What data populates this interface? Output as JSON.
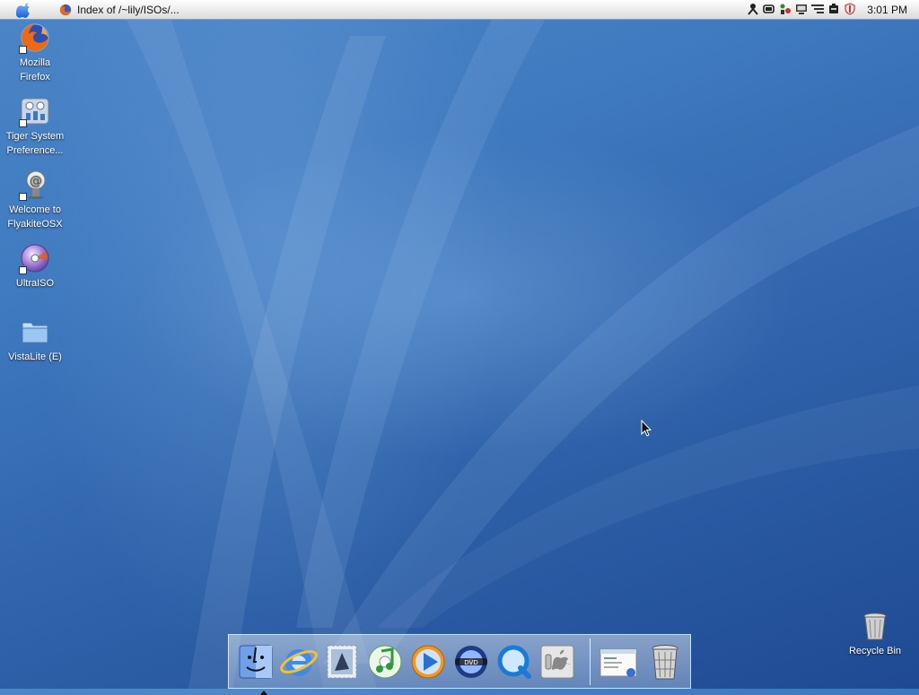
{
  "menubar": {
    "task_title": "Index of /~lily/ISOs/...",
    "clock": "3:01 PM",
    "tray_icons": [
      "speech-icon",
      "battery-icon",
      "network-icon",
      "monitor-icon",
      "volume-bars-icon",
      "connection-icon",
      "shield-icon"
    ]
  },
  "desktop": {
    "icons": [
      {
        "label1": "Mozilla",
        "label2": "Firefox",
        "icon": "firefox-icon"
      },
      {
        "label1": "Tiger System",
        "label2": "Preference...",
        "icon": "system-preferences-icon"
      },
      {
        "label1": "Welcome to",
        "label2": "FlyakiteOSX",
        "icon": "welcome-icon"
      },
      {
        "label1": "UltraISO",
        "label2": "",
        "icon": "disc-icon"
      },
      {
        "label1": "VistaLite (E)",
        "label2": "",
        "icon": "folder-icon"
      }
    ],
    "recycle_bin": "Recycle Bin"
  },
  "dock": {
    "items": [
      "finder-icon",
      "internet-explorer-icon",
      "mail-stamp-icon",
      "itunes-icon",
      "media-player-icon",
      "dvd-player-icon",
      "quicktime-icon",
      "system-preferences-switch-icon",
      "window-preview-icon",
      "trash-icon"
    ]
  },
  "colors": {
    "wallpaper_top": "#4c86c8",
    "wallpaper_bottom": "#1f4a93"
  }
}
